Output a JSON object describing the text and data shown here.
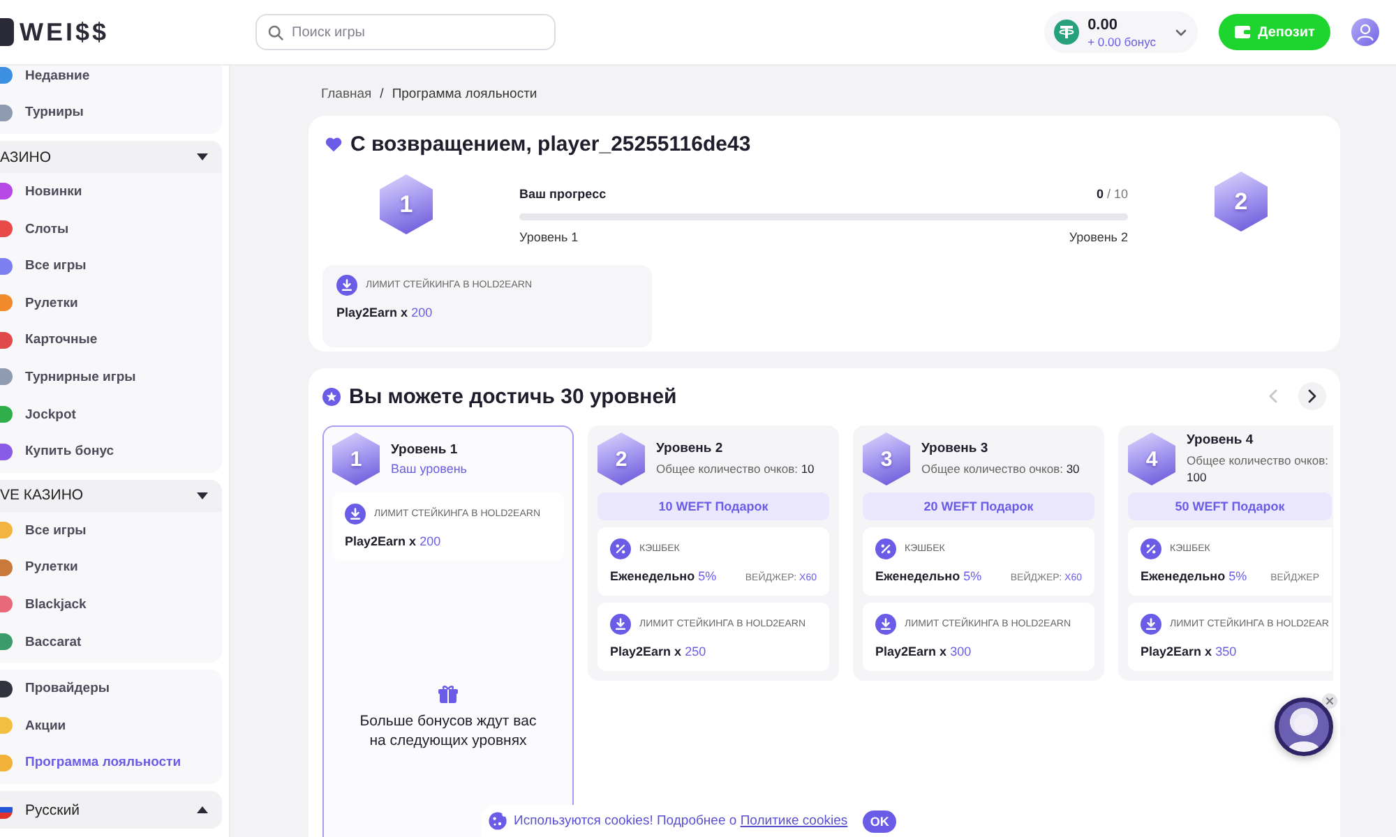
{
  "header": {
    "logo": "WEI$$",
    "search": {
      "placeholder": "Поиск игры"
    },
    "balance": {
      "amount": "0.00",
      "bonus": "+ 0.00 бонус"
    },
    "deposit_button": "Депозит"
  },
  "sidebar": {
    "groups": [
      {
        "items": [
          {
            "label": "Недавние",
            "selected": false
          },
          {
            "label": "Турниры",
            "selected": false
          }
        ]
      },
      {
        "title": "АЗИНО",
        "expanded": true,
        "items": [
          {
            "label": "Новинки",
            "selected": false
          },
          {
            "label": "Слоты",
            "selected": false
          },
          {
            "label": "Все игры",
            "selected": false
          },
          {
            "label": "Рулетки",
            "selected": false
          },
          {
            "label": "Карточные",
            "selected": false
          },
          {
            "label": "Турнирные игры",
            "selected": false
          },
          {
            "label": "Jockpot",
            "selected": false
          },
          {
            "label": "Купить бонус",
            "selected": false
          }
        ]
      },
      {
        "title": "VE КАЗИНО",
        "expanded": true,
        "items": [
          {
            "label": "Все игры",
            "selected": false
          },
          {
            "label": "Рулетки",
            "selected": false
          },
          {
            "label": "Blackjack",
            "selected": false
          },
          {
            "label": "Baccarat",
            "selected": false
          }
        ]
      },
      {
        "items": [
          {
            "label": "Провайдеры",
            "selected": false
          },
          {
            "label": "Акции",
            "selected": false
          },
          {
            "label": "Программа лояльности",
            "selected": true
          }
        ]
      }
    ],
    "language": {
      "label": "Русский"
    }
  },
  "breadcrumb": {
    "items": [
      "Главная",
      "Программа лояльности"
    ],
    "separator": "/"
  },
  "welcome": {
    "title": "С возвращением, player_25255116de43",
    "current_badge": "1",
    "next_badge": "2",
    "progress": {
      "label": "Ваш прогресс",
      "value": "0",
      "total": "/ 10",
      "from": "Уровень 1",
      "to": "Уровень 2"
    },
    "perk": {
      "kind": "staking",
      "title": "ЛИМИТ СТЕЙКИНГА В HOLD2EARN",
      "label": "Play2Earn x",
      "value": "200"
    }
  },
  "levels": {
    "title": "Вы можете достичь 30 уровней",
    "nav": [
      {
        "kind": "prev",
        "disabled": true
      },
      {
        "kind": "next",
        "disabled": false
      }
    ],
    "items": [
      {
        "badge": "1",
        "title": "Уровень 1",
        "selected": true,
        "status": "Ваш уровень",
        "perks": [
          {
            "kind": "staking",
            "title": "ЛИМИТ СТЕЙКИНГА В HOLD2EARN",
            "label": "Play2Earn x",
            "value": "200"
          }
        ],
        "teaser": "Больше бонусов ждут вас на следующих уровнях"
      },
      {
        "badge": "2",
        "title": "Уровень 2",
        "selected": false,
        "points_label": "Общее количество очков:",
        "points": "10",
        "gift": "10 WEFT Подарок",
        "perks": [
          {
            "kind": "cashback",
            "title": "КЭШБЕК",
            "label": "Еженедельно",
            "value": "5%",
            "wager_label": "ВЕЙДЖЕР:",
            "wager": "X60"
          },
          {
            "kind": "staking",
            "title": "ЛИМИТ СТЕЙКИНГА В HOLD2EARN",
            "label": "Play2Earn x",
            "value": "250"
          }
        ]
      },
      {
        "badge": "3",
        "title": "Уровень 3",
        "selected": false,
        "points_label": "Общее количество очков:",
        "points": "30",
        "gift": "20 WEFT Подарок",
        "perks": [
          {
            "kind": "cashback",
            "title": "КЭШБЕК",
            "label": "Еженедельно",
            "value": "5%",
            "wager_label": "ВЕЙДЖЕР:",
            "wager": "X60"
          },
          {
            "kind": "staking",
            "title": "ЛИМИТ СТЕЙКИНГА В HOLD2EARN",
            "label": "Play2Earn x",
            "value": "300"
          }
        ]
      },
      {
        "badge": "4",
        "title": "Уровень 4",
        "selected": false,
        "points_label": "Общее количество очков:",
        "points": "100",
        "gift": "50 WEFT Подарок",
        "perks": [
          {
            "kind": "cashback",
            "title": "КЭШБЕК",
            "label": "Еженедельно",
            "value": "5%",
            "wager_label": "ВЕЙДЖЕР"
          },
          {
            "kind": "staking",
            "title": "ЛИМИТ СТЕЙКИНГА В HOLD2EAR",
            "label": "Play2Earn x",
            "value": "350"
          }
        ]
      }
    ]
  },
  "cookie_banner": {
    "text": "Используются cookies! Подробнее о",
    "link": "Политике cookies",
    "button": "OK"
  }
}
